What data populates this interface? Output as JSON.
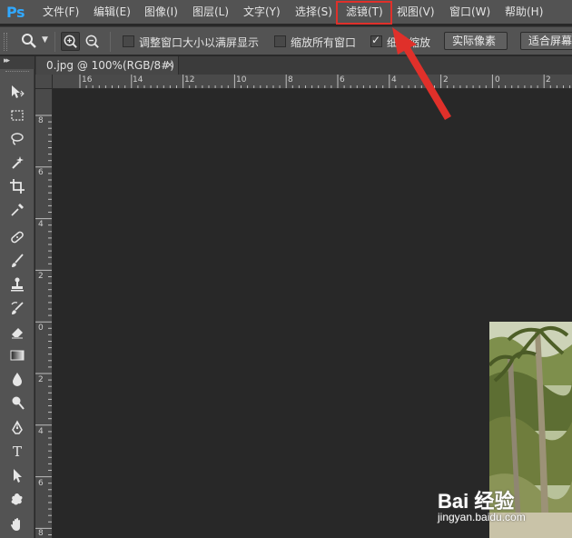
{
  "app": {
    "logo": "Ps",
    "brand_color": "#31a8ff"
  },
  "menu": {
    "items": [
      "文件(F)",
      "编辑(E)",
      "图像(I)",
      "图层(L)",
      "文字(Y)",
      "选择(S)",
      "滤镜(T)",
      "视图(V)",
      "窗口(W)",
      "帮助(H)"
    ],
    "highlighted": "滤镜(T)",
    "highlight_color": "#e0302a"
  },
  "options": {
    "tool_icon": "zoom-tool-icon",
    "zoom_in_icon": "zoom-in-icon",
    "zoom_out_icon": "zoom-out-icon",
    "resize_windows": {
      "label": "调整窗口大小以满屏显示",
      "checked": false
    },
    "zoom_all_windows": {
      "label": "缩放所有窗口",
      "checked": false
    },
    "scrubby_zoom": {
      "label": "细微缩放",
      "checked": true
    },
    "actual_pixels": "实际像素",
    "fit_screen": "适合屏幕"
  },
  "document": {
    "tab_title": "0.jpg @ 100%(RGB/8#)",
    "close_glyph": "×"
  },
  "rulers": {
    "top_labels": [
      "16",
      "14",
      "12",
      "10",
      "8",
      "6",
      "4",
      "2",
      "0",
      "2"
    ],
    "left_labels": [
      "8",
      "6",
      "4",
      "2",
      "0",
      "2",
      "4",
      "6",
      "8"
    ]
  },
  "toolbar": {
    "tools": [
      "move-tool-icon",
      "marquee-tool-icon",
      "lasso-tool-icon",
      "magic-wand-tool-icon",
      "crop-tool-icon",
      "eyedropper-tool-icon",
      "healing-brush-tool-icon",
      "brush-tool-icon",
      "clone-stamp-tool-icon",
      "history-brush-tool-icon",
      "eraser-tool-icon",
      "gradient-tool-icon",
      "blur-tool-icon",
      "dodge-tool-icon",
      "pen-tool-icon",
      "type-tool-icon",
      "path-selection-tool-icon",
      "shape-tool-icon",
      "hand-tool-icon"
    ],
    "type_glyph": "T"
  },
  "watermark": {
    "logo": "Bai 经验",
    "url": "jingyan.baidu.com"
  },
  "colors": {
    "ui_panel": "#535353",
    "canvas_bg": "#282828",
    "annotation_red": "#e0302a"
  }
}
